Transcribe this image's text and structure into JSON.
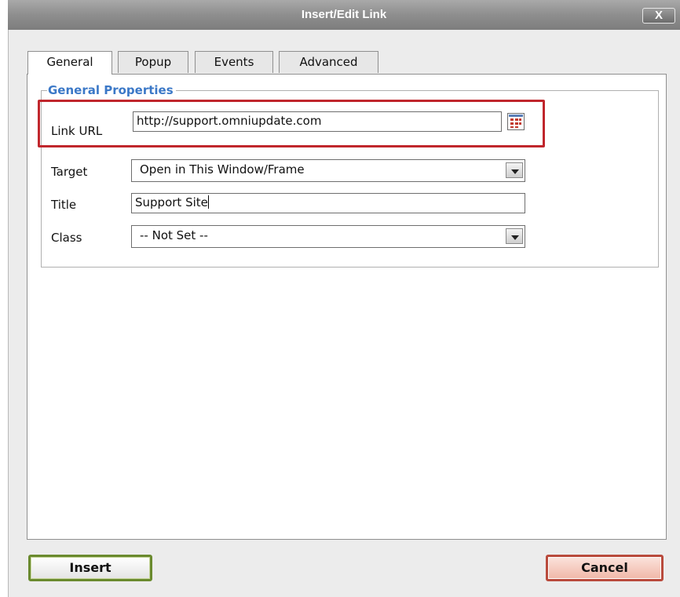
{
  "window": {
    "title": "Insert/Edit Link",
    "close_label": "X"
  },
  "tabs": [
    {
      "label": "General",
      "active": true
    },
    {
      "label": "Popup",
      "active": false
    },
    {
      "label": "Events",
      "active": false
    },
    {
      "label": "Advanced",
      "active": false
    }
  ],
  "general_properties": {
    "legend": "General Properties",
    "link_url": {
      "label": "Link URL",
      "value": "http://support.omniupdate.com"
    },
    "target": {
      "label": "Target",
      "value": "Open in This Window/Frame"
    },
    "title": {
      "label": "Title",
      "value": "Support Site"
    },
    "class": {
      "label": "Class",
      "value": "-- Not Set --"
    }
  },
  "buttons": {
    "insert": "Insert",
    "cancel": "Cancel"
  },
  "colors": {
    "legend": "#3b78c7",
    "highlight": "#c0262c",
    "insert_border": "#6a8a2e",
    "cancel_border": "#b94a3c",
    "titlebar": "#8e8e8e"
  },
  "icons": {
    "browse": "browse-file-icon",
    "dropdown": "chevron-down-icon",
    "close": "close-icon"
  }
}
